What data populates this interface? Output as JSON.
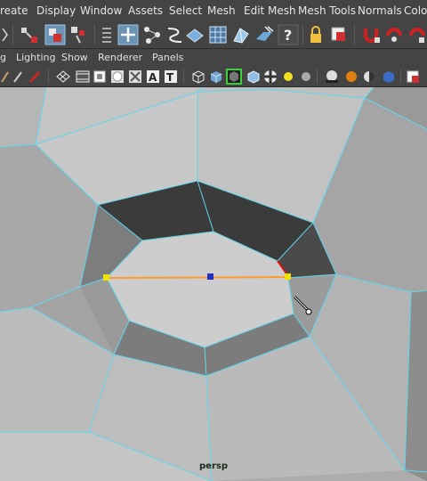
{
  "menubar": {
    "items": [
      "reate",
      "Display",
      "Window",
      "Assets",
      "Select",
      "Mesh",
      "Edit Mesh",
      "Mesh Tools",
      "Normals",
      "Colo"
    ]
  },
  "panel_menu": {
    "items": [
      "g",
      "Lighting",
      "Show",
      "Renderer",
      "Panels"
    ]
  },
  "viewport": {
    "camera_label": "persp"
  },
  "colors": {
    "ui_bg": "#444444",
    "wire": "#5fd8ee",
    "selected_edge": "#ff9a2e",
    "vertex_selected": "#f0e000",
    "vertex_mid": "#2030c0",
    "hilite_edge": "#e01010"
  },
  "icons": {
    "shelf": [
      "scale-arrow-icon",
      "select-object-icon",
      "lasso-icon",
      "channel-toggle-icon",
      "move-icon",
      "connect-icon",
      "multicut-icon",
      "bevel-icon",
      "grid-icon",
      "extrude-icon",
      "help-icon",
      "lock-icon",
      "snap-icon",
      "magnet-icon",
      "magnet-icon",
      "magnet-icon"
    ],
    "view": [
      "brush-icon",
      "pencil-icon",
      "grid-icon",
      "film-icon",
      "frame-icon",
      "circle-icon",
      "x-icon",
      "text-icon",
      "wireframe-cube-icon",
      "shaded-cube-icon",
      "xray-cube-icon",
      "textured-icon",
      "checker-icon",
      "light-bulb-icon",
      "sphere-icon",
      "shadow-icon",
      "orange-sphere-icon",
      "half-sphere-icon",
      "blue-cube-icon",
      "isolate-icon"
    ]
  }
}
